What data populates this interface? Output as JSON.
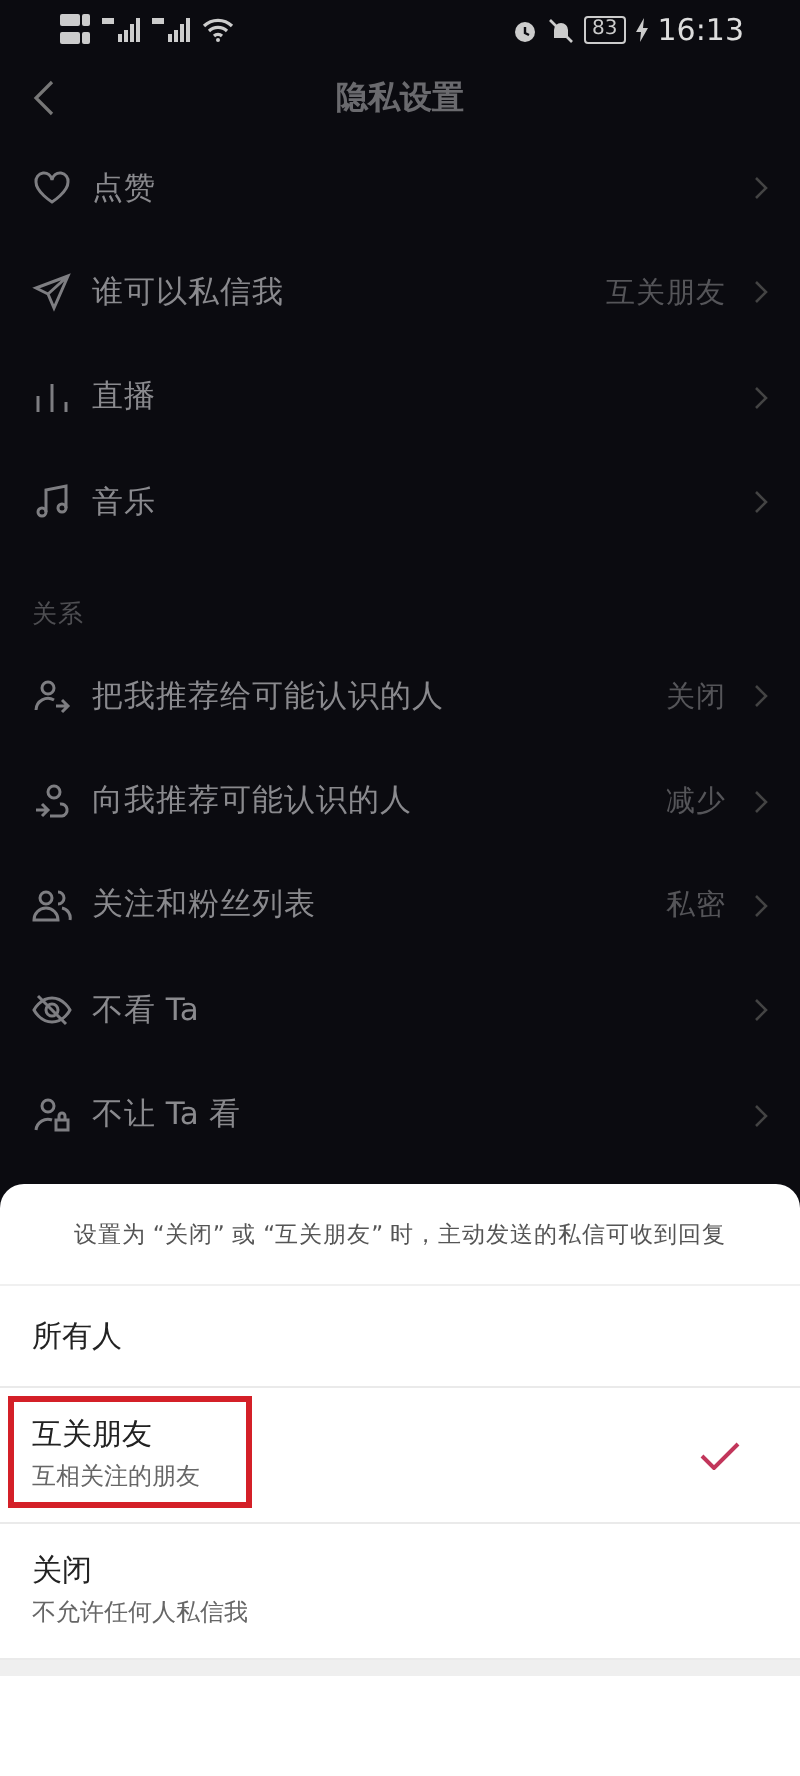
{
  "status_bar": {
    "battery": "83",
    "time": "16:13"
  },
  "nav": {
    "title": "隐私设置"
  },
  "groups": [
    {
      "items": [
        {
          "label": "点赞"
        },
        {
          "label": "谁可以私信我",
          "value": "互关朋友"
        },
        {
          "label": "直播"
        },
        {
          "label": "音乐"
        }
      ]
    },
    {
      "header": "关系",
      "items": [
        {
          "label": "把我推荐给可能认识的人",
          "value": "关闭"
        },
        {
          "label": "向我推荐可能认识的人",
          "value": "减少"
        },
        {
          "label": "关注和粉丝列表",
          "value": "私密"
        },
        {
          "label": "不看 Ta"
        },
        {
          "label": "不让 Ta 看"
        }
      ]
    }
  ],
  "sheet": {
    "note": "设置为 “关闭” 或 “互关朋友” 时，主动发送的私信可收到回复",
    "options": [
      {
        "title": "所有人",
        "selected": false,
        "highlighted": false
      },
      {
        "title": "互关朋友",
        "subtitle": "互相关注的朋友",
        "selected": true,
        "highlighted": true
      },
      {
        "title": "关闭",
        "subtitle": "不允许任何人私信我",
        "selected": false,
        "highlighted": false
      }
    ]
  }
}
